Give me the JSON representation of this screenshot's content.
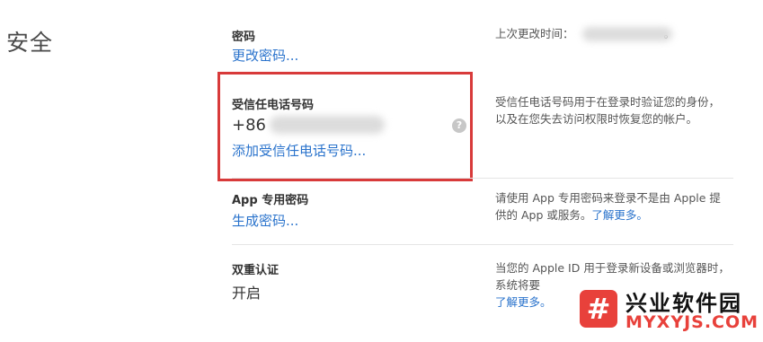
{
  "section": {
    "title": "安全"
  },
  "password": {
    "label": "密码",
    "link": "更改密码...",
    "desc_prefix": "上次更改时间：",
    "desc_suffix": "。"
  },
  "trusted_phone": {
    "label": "受信任电话号码",
    "number_prefix": "+86",
    "add_link": "添加受信任电话号码...",
    "info_icon": "?",
    "desc": "受信任电话号码用于在登录时验证您的身份，以及在您失去访问权限时恢复您的帐户。"
  },
  "app_password": {
    "label": "App 专用密码",
    "link": "生成密码...",
    "desc": "请使用 App 专用密码来登录不是由 Apple 提供的 App 或服务。",
    "desc_link": "了解更多。"
  },
  "two_factor": {
    "label": "双重认证",
    "value": "开启",
    "desc": "当您的 Apple ID 用于登录新设备或浏览器时，系统将要",
    "desc_link": "了解更多。"
  },
  "watermark": {
    "logo": "#",
    "name_cn": "兴业软件园",
    "name_en": "MYXYJS.COM"
  },
  "colors": {
    "accent_link": "#2a73cc",
    "highlight_border": "#d83a3a",
    "watermark_red": "#e8413b"
  }
}
